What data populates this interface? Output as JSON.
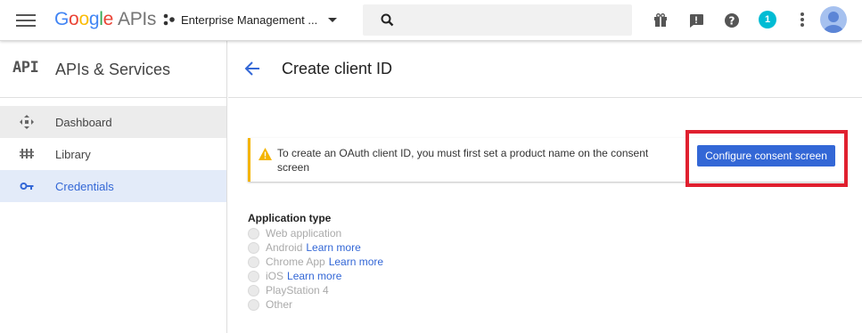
{
  "header": {
    "logo": {
      "g1": "G",
      "g2": "o",
      "g3": "o",
      "g4": "g",
      "g5": "l",
      "g6": "e",
      "suffix": "APIs"
    },
    "project_name": "Enterprise Management ...",
    "notification_count": "1",
    "icons": [
      "menu-icon",
      "project-dots-icon",
      "chevron-down-icon",
      "search-icon",
      "gift-icon",
      "feedback-icon",
      "help-icon",
      "more-vert-icon",
      "avatar"
    ]
  },
  "sidebar": {
    "api_mark": "API",
    "title": "APIs & Services",
    "items": [
      {
        "label": "Dashboard",
        "icon": "dashboard-icon"
      },
      {
        "label": "Library",
        "icon": "library-icon"
      },
      {
        "label": "Credentials",
        "icon": "key-icon",
        "active": true
      }
    ]
  },
  "main": {
    "title": "Create client ID",
    "warning": "To create an OAuth client ID, you must first set a product name on the consent screen",
    "configure_button": "Configure consent screen",
    "app_type_label": "Application type",
    "options": [
      {
        "label": "Web application",
        "link": ""
      },
      {
        "label": "Android",
        "link": "Learn more"
      },
      {
        "label": "Chrome App",
        "link": "Learn more"
      },
      {
        "label": "iOS",
        "link": "Learn more"
      },
      {
        "label": "PlayStation 4",
        "link": ""
      },
      {
        "label": "Other",
        "link": ""
      }
    ]
  },
  "colors": {
    "accent": "#3367d6",
    "warning": "#f4b400",
    "highlight_box": "#e0202f",
    "badge": "#00bcd4"
  }
}
